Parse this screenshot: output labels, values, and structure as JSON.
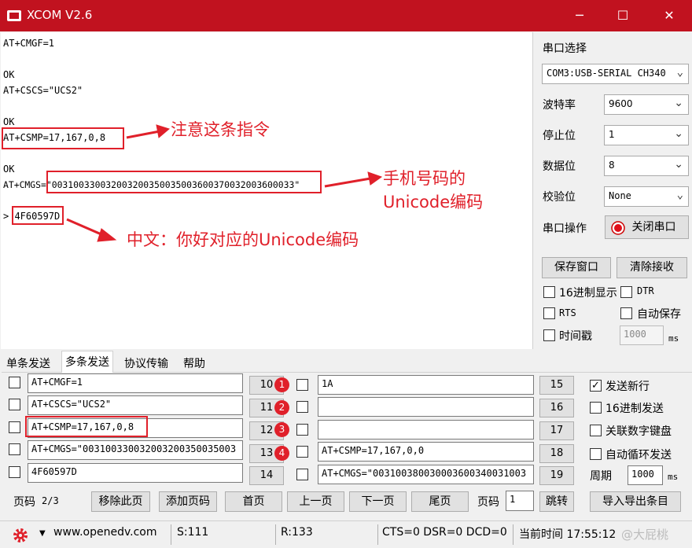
{
  "window": {
    "title": "XCOM V2.6",
    "minimize": "─",
    "maximize": "☐",
    "close": "✕"
  },
  "receive": {
    "lines": [
      "AT+CMGF=1",
      "OK",
      "AT+CSCS=\"UCS2\"",
      "OK",
      "AT+CSMP=17,167,0,8",
      "OK",
      "AT+CMGS=\"003100330032003200350035003600370032003600033\"",
      "> 4F60597D"
    ],
    "annotations": [
      "注意这条指令",
      "手机号码的Unicode编码",
      "中文：你好对应的Unicode编码"
    ]
  },
  "serial": {
    "port_label": "串口选择",
    "port_value": "COM3:USB-SERIAL CH340",
    "baud_label": "波特率",
    "baud_value": "9600",
    "stop_label": "停止位",
    "stop_value": "1",
    "data_label": "数据位",
    "data_value": "8",
    "parity_label": "校验位",
    "parity_value": "None",
    "op_label": "串口操作",
    "op_button": "关闭串口",
    "save_window": "保存窗口",
    "clear_recv": "清除接收",
    "hex_display": "16进制显示",
    "dtr": "DTR",
    "rts": "RTS",
    "auto_save": "自动保存",
    "timestamp": "时间戳",
    "timestamp_value": "1000",
    "ms": "ms"
  },
  "tabs": [
    "单条发送",
    "多条发送",
    "协议传输",
    "帮助"
  ],
  "multi": {
    "left_rows": [
      {
        "value": "AT+CMGF=1",
        "num": "10",
        "badge": "1"
      },
      {
        "value": "AT+CSCS=\"UCS2\"",
        "num": "11",
        "badge": "2"
      },
      {
        "value": "AT+CSMP=17,167,0,8",
        "num": "12",
        "badge": "3"
      },
      {
        "value": "AT+CMGS=\"003100330032003200350035003",
        "num": "13",
        "badge": "4"
      },
      {
        "value": "4F60597D",
        "num": "14",
        "badge": ""
      }
    ],
    "right_rows": [
      {
        "value": "1A",
        "num": "15"
      },
      {
        "value": "",
        "num": "16"
      },
      {
        "value": "",
        "num": "17"
      },
      {
        "value": "AT+CSMP=17,167,0,0",
        "num": "18"
      },
      {
        "value": "AT+CMGS=\"003100380030003600340031003",
        "num": "19"
      }
    ],
    "send_newline": "发送新行",
    "hex_send": "16进制发送",
    "link_keypad": "关联数字键盘",
    "auto_loop": "自动循环发送",
    "period_label": "周期",
    "period_value": "1000",
    "ms": "ms"
  },
  "pager": {
    "page_label": "页码",
    "page_value": "2/3",
    "remove": "移除此页",
    "add": "添加页码",
    "first": "首页",
    "prev": "上一页",
    "next": "下一页",
    "last": "尾页",
    "goto_label": "页码",
    "goto_value": "1",
    "jump": "跳转",
    "import_export": "导入导出条目"
  },
  "status": {
    "url": "www.openedv.com",
    "sent": "S:111",
    "recv": "R:133",
    "lines": "CTS=0 DSR=0 DCD=0",
    "time": "当前时间 17:55:12",
    "watermark": "@大屁桃"
  },
  "colors": {
    "titlebar": "#c1121f",
    "annotation": "#e0202a"
  }
}
